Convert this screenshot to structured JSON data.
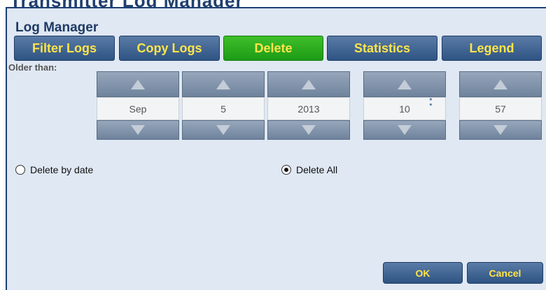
{
  "background": {
    "window_title": "Transmitter Log Manager"
  },
  "dialog": {
    "title": "Log Manager",
    "tabs": [
      {
        "label": "Filter Logs",
        "active": false
      },
      {
        "label": "Copy Logs",
        "active": false
      },
      {
        "label": "Delete",
        "active": true
      },
      {
        "label": "Statistics",
        "active": false
      },
      {
        "label": "Legend",
        "active": false
      }
    ],
    "older_than_label": "Older than:",
    "date": {
      "month": "Sep",
      "day": "5",
      "year": "2013"
    },
    "time": {
      "hour": "10",
      "minute": "57",
      "separator": ":"
    },
    "options": {
      "delete_by_date": {
        "label": "Delete by date",
        "selected": false
      },
      "delete_all": {
        "label": "Delete All",
        "selected": true
      }
    },
    "ok_label": "OK",
    "cancel_label": "Cancel"
  },
  "colors": {
    "accent": "#ffe44a",
    "active_tab": "#2aa81e",
    "button": "#3d6393",
    "panel": "#dfe8f3"
  },
  "icons": {
    "up": "triangle-up-icon",
    "down": "triangle-down-icon"
  }
}
